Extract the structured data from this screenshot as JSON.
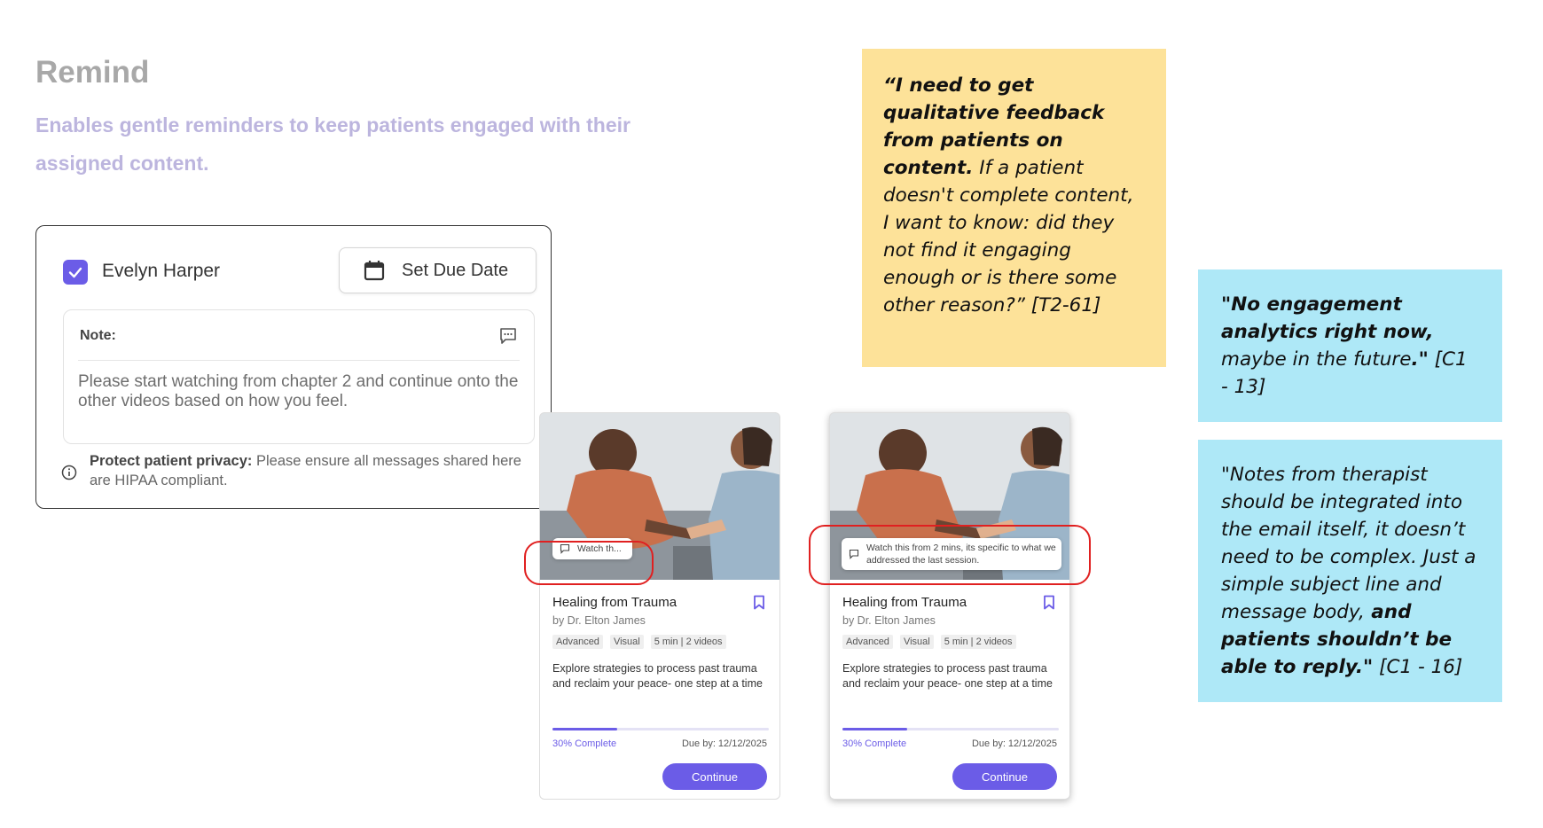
{
  "header": {
    "title": "Remind",
    "subtitle": "Enables gentle reminders to keep patients engaged with their assigned content."
  },
  "reminder_panel": {
    "patient_name": "Evelyn Harper",
    "patient_checked": true,
    "due_date_button": "Set Due Date",
    "note_label": "Note:",
    "note_text": "Please start watching from chapter 2 and continue onto the other videos based on how you feel.",
    "privacy_bold": "Protect patient privacy:",
    "privacy_text": " Please ensure all messages shared here are HIPAA compliant."
  },
  "cards": [
    {
      "tooltip": "Watch th...",
      "title": "Healing from Trauma",
      "author": "by Dr. Elton James",
      "tags": [
        "Advanced",
        "Visual",
        "5 min | 2 videos"
      ],
      "description": "Explore strategies to process past trauma and reclaim your peace- one step at a time",
      "progress_fraction": 0.3,
      "progress_label": "30% Complete",
      "due": "Due by: 12/12/2025",
      "cta": "Continue"
    },
    {
      "tooltip": "Watch this from 2 mins, its specific to what we addressed the last session.",
      "title": "Healing from Trauma",
      "author": "by Dr. Elton James",
      "tags": [
        "Advanced",
        "Visual",
        "5 min | 2 videos"
      ],
      "description": "Explore strategies to process past trauma and reclaim your peace- one step at a time",
      "progress_fraction": 0.3,
      "progress_label": "30% Complete",
      "due": "Due by: 12/12/2025",
      "cta": "Continue"
    }
  ],
  "notes": {
    "yellow": {
      "bold": "“I need to get qualitative feedback from patients on content.",
      "rest": " If a patient doesn't complete content, I want to know: did they not find it engaging enough or is there some other reason?” [T2-61]"
    },
    "blue1": {
      "bold": "\"No engagement analytics right now,",
      "middle": " maybe in the future",
      "bold_end": ".\"",
      "rest": " [C1 - 13]"
    },
    "blue2": {
      "text": "\"Notes from therapist should be integrated into the email itself, it doesn’t need to be complex. Just a simple subject line and message body,",
      "bold": " and patients shouldn’t be able to reply.\"",
      "rest": " [C1 - 16]"
    }
  },
  "colors": {
    "accent": "#6b5ce7",
    "highlight_ring": "#e02020",
    "sticky_yellow": "#fde299",
    "sticky_blue": "#aee8f7"
  },
  "icons": [
    "check-icon",
    "calendar-icon",
    "comment-icon",
    "info-icon",
    "bookmark-icon"
  ]
}
